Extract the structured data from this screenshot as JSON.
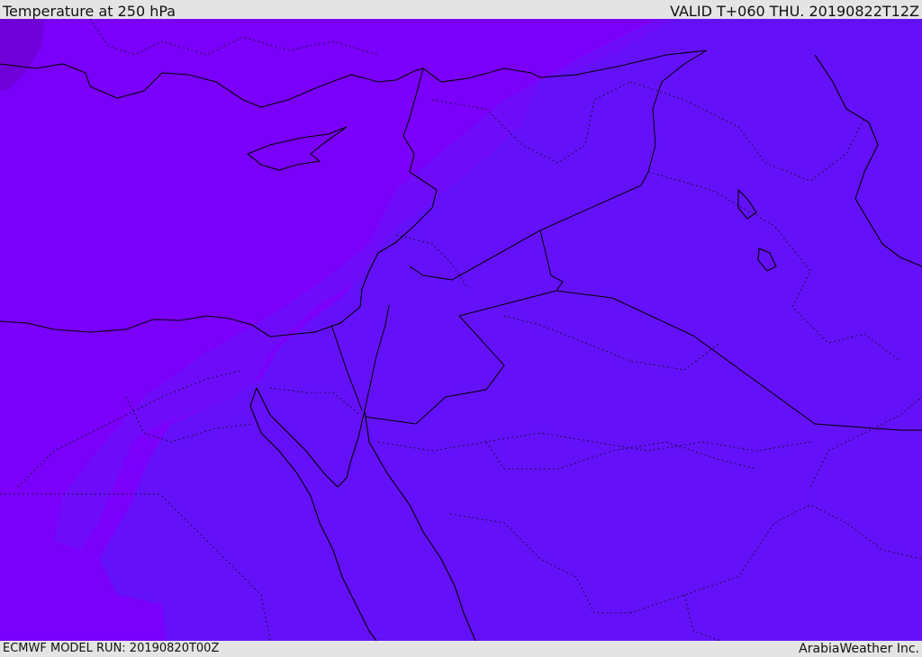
{
  "header": {
    "title": "Temperature at 250 hPa",
    "valid": "VALID T+060 THU. 20190822T12Z"
  },
  "footer": {
    "model_run": "ECMWF MODEL RUN: 20190820T00Z",
    "credit": "ArabiaWeather Inc."
  },
  "map": {
    "field_colors": {
      "warmer_zone": "#7b00fb",
      "cooler_zone": "#6411fa",
      "transition_band": "#6e0cfa",
      "coldest_patch": "#7000d8"
    },
    "line_colors": {
      "coastline": "#000000",
      "border": "#1a0d40"
    }
  }
}
